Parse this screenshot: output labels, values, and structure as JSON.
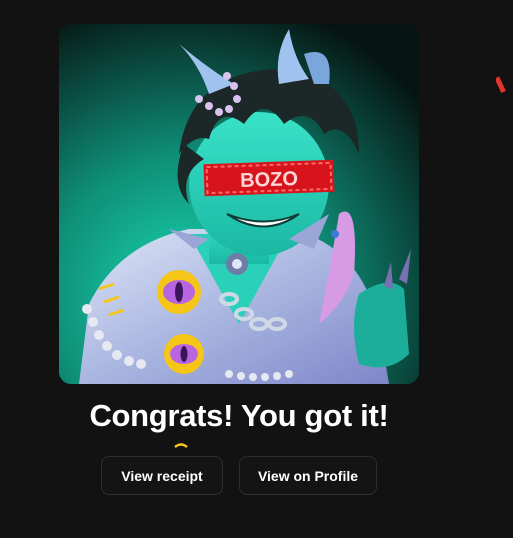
{
  "artwork": {
    "badge_text": "BOZO",
    "colors": {
      "background_top": "#0a1f1c",
      "background_glow": "#17c9a6",
      "skin": "#2fd9c1",
      "hair": "#1d2a2a",
      "jacket": "#b9c8e6",
      "badge_red": "#d7141c",
      "horn": "#8fb6e8",
      "eye_charm": "#8a3fc0"
    }
  },
  "message": {
    "title": "Congrats! You got it!"
  },
  "actions": {
    "view_receipt": "View receipt",
    "view_on_profile": "View on Profile"
  },
  "confetti_colors": [
    "#e0352b",
    "#f5c518"
  ]
}
